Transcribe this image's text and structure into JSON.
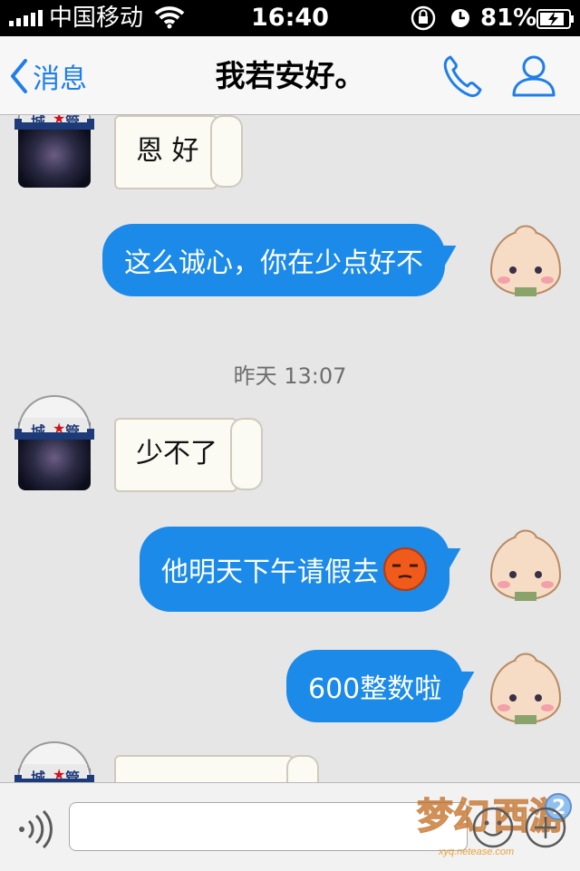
{
  "status_bar": {
    "carrier": "中国移动",
    "time": "16:40",
    "battery_percent": "81%"
  },
  "nav": {
    "back_label": "消息",
    "title": "我若安好。"
  },
  "messages": [
    {
      "side": "left",
      "text": "恩 好",
      "style": "paper"
    },
    {
      "side": "right",
      "text": "这么诚心，你在少点好不",
      "style": "blue"
    },
    {
      "type": "timestamp",
      "text": "昨天 13:07"
    },
    {
      "side": "left",
      "text": "少不了",
      "style": "paper"
    },
    {
      "side": "right",
      "text": "他明天下午请假去",
      "style": "blue",
      "emoji": "sleepy-face"
    },
    {
      "side": "right",
      "text": "600整数啦",
      "style": "blue"
    },
    {
      "side": "left",
      "text": "",
      "style": "paper",
      "partial": true
    }
  ],
  "avatar_badge": {
    "left": "城",
    "right": "管"
  },
  "input": {
    "value": "",
    "placeholder": ""
  },
  "watermark": {
    "url": "xyq.netease.com"
  },
  "colors": {
    "accent": "#1f7ee8",
    "bubble_blue": "#1b8ae8",
    "background": "#e6e6e6"
  },
  "icons": [
    "wifi-icon",
    "rotation-lock-icon",
    "alarm-icon",
    "battery-icon",
    "back-chevron-icon",
    "phone-icon",
    "profile-icon",
    "voice-icon",
    "emoji-icon",
    "plus-icon"
  ]
}
